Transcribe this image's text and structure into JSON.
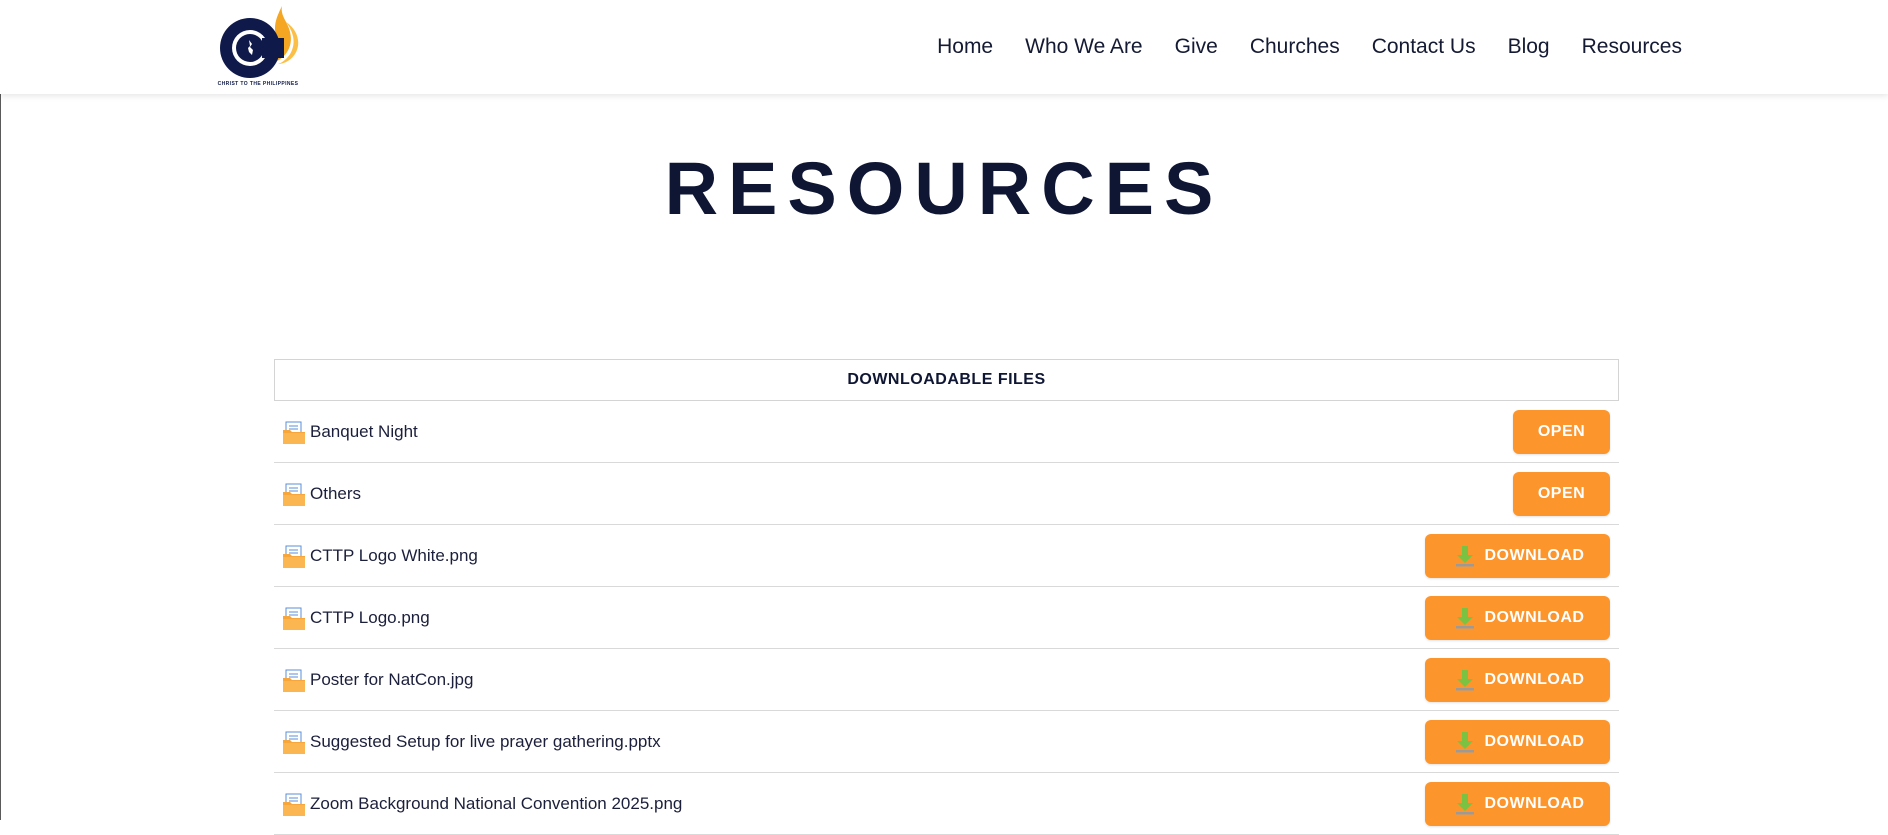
{
  "site": {
    "logo_tagline": "CHRIST TO THE PHILIPPINES",
    "brand_colors": {
      "navy": "#0f1a4a",
      "orange": "#fd952d",
      "flame": "#f5a623"
    }
  },
  "nav": {
    "items": [
      {
        "label": "Home"
      },
      {
        "label": "Who We Are"
      },
      {
        "label": "Give"
      },
      {
        "label": "Churches"
      },
      {
        "label": "Contact Us"
      },
      {
        "label": "Blog"
      },
      {
        "label": "Resources"
      }
    ]
  },
  "page": {
    "title": "RESOURCES"
  },
  "files": {
    "header": "DOWNLOADABLE FILES",
    "rows": [
      {
        "name": "Banquet Night",
        "icon": "folder-icon",
        "action": "OPEN"
      },
      {
        "name": "Others",
        "icon": "folder-icon",
        "action": "OPEN"
      },
      {
        "name": "CTTP Logo White.png",
        "icon": "file-icon",
        "action": "DOWNLOAD"
      },
      {
        "name": "CTTP Logo.png",
        "icon": "file-icon",
        "action": "DOWNLOAD"
      },
      {
        "name": "Poster for NatCon.jpg",
        "icon": "file-icon",
        "action": "DOWNLOAD"
      },
      {
        "name": "Suggested Setup for live prayer gathering.pptx",
        "icon": "file-icon",
        "action": "DOWNLOAD"
      },
      {
        "name": "Zoom Background National Convention 2025.png",
        "icon": "file-icon",
        "action": "DOWNLOAD"
      }
    ]
  }
}
